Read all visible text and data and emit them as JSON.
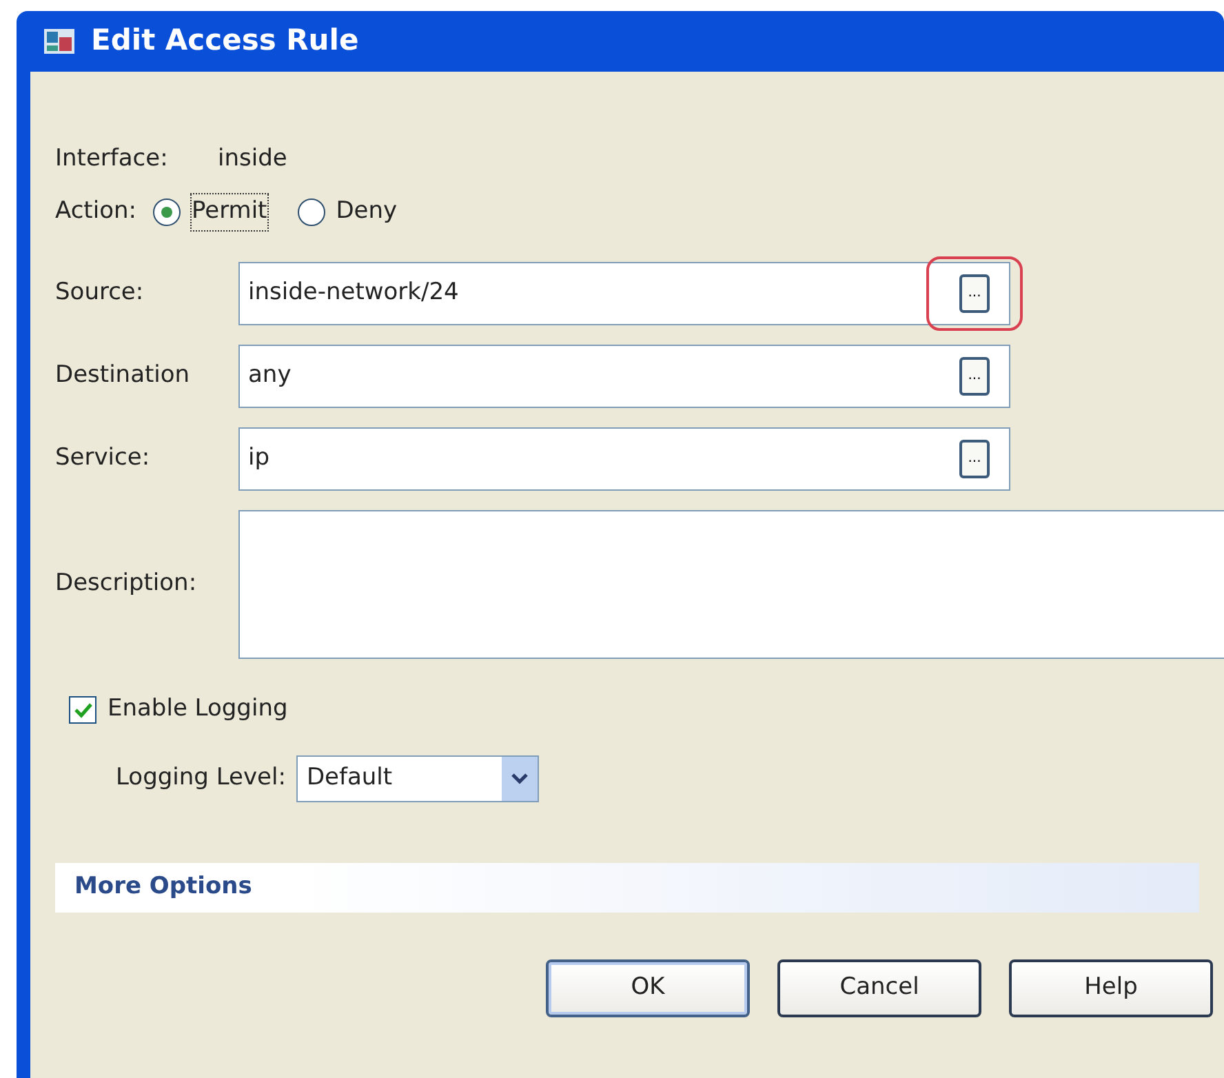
{
  "window": {
    "title": "Edit Access Rule"
  },
  "interface": {
    "label": "Interface:",
    "value": "inside"
  },
  "action": {
    "label": "Action:",
    "options": [
      {
        "label": "Permit",
        "selected": true
      },
      {
        "label": "Deny",
        "selected": false
      }
    ]
  },
  "fields": [
    {
      "label": "Source:",
      "value": "inside-network/24",
      "browse": "...",
      "highlighted": true
    },
    {
      "label": "Destination",
      "value": "any",
      "browse": "...",
      "highlighted": false
    },
    {
      "label": "Service:",
      "value": "ip",
      "browse": "...",
      "highlighted": false
    }
  ],
  "description": {
    "label": "Description:"
  },
  "enable_logging": {
    "label": "Enable Logging",
    "checked": true
  },
  "logging_level": {
    "label": "Logging Level:",
    "value": "Default"
  },
  "more_options": {
    "label": "More Options"
  },
  "buttons": [
    "OK",
    "Cancel",
    "Help"
  ]
}
